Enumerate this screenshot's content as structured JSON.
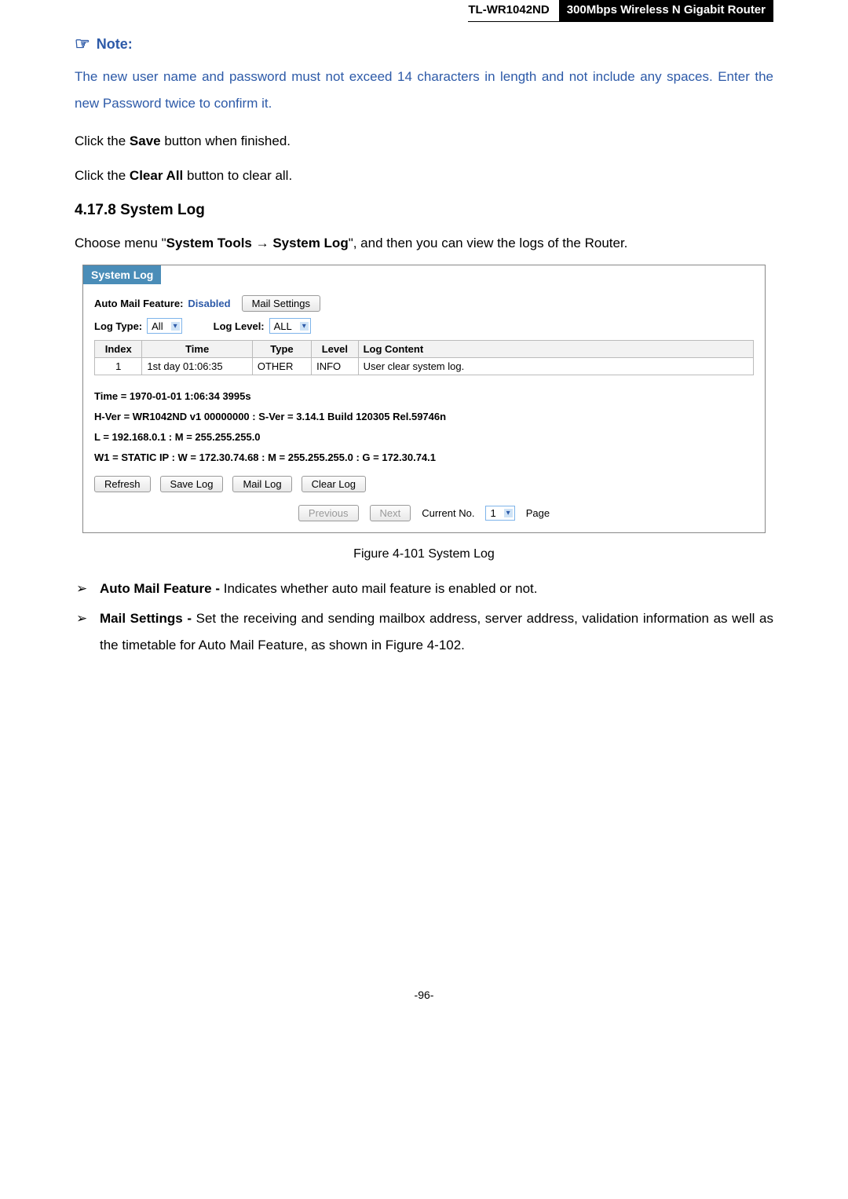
{
  "header": {
    "model": "TL-WR1042ND",
    "product": "300Mbps Wireless N Gigabit Router"
  },
  "note": {
    "label": "Note:",
    "text": "The new user name and password must not exceed 14 characters in length and not include any spaces. Enter the new Password twice to confirm it."
  },
  "para1_pre": "Click the ",
  "para1_bold": "Save",
  "para1_post": " button when finished.",
  "para2_pre": "Click the ",
  "para2_bold": "Clear All",
  "para2_post": " button to clear all.",
  "section_heading": "4.17.8  System Log",
  "choose_pre": "Choose menu \"",
  "choose_b1": "System Tools",
  "choose_arrow": " → ",
  "choose_b2": "System Log",
  "choose_post": "\", and then you can view the logs of the Router.",
  "syslog": {
    "title": "System Log",
    "auto_mail_label": "Auto Mail Feature:",
    "auto_mail_status": "Disabled",
    "mail_settings_btn": "Mail Settings",
    "log_type_label": "Log Type:",
    "log_type_value": "All",
    "log_level_label": "Log Level:",
    "log_level_value": "ALL",
    "headers": {
      "index": "Index",
      "time": "Time",
      "type": "Type",
      "level": "Level",
      "content": "Log Content"
    },
    "rows": [
      {
        "index": "1",
        "time": "1st day 01:06:35",
        "type": "OTHER",
        "level": "INFO",
        "content": "User clear system log."
      }
    ],
    "info": {
      "l1": "Time = 1970-01-01 1:06:34 3995s",
      "l2": "H-Ver = WR1042ND v1 00000000 : S-Ver = 3.14.1 Build 120305 Rel.59746n",
      "l3": "L = 192.168.0.1 : M = 255.255.255.0",
      "l4": "W1 = STATIC IP : W = 172.30.74.68 : M = 255.255.255.0 : G = 172.30.74.1"
    },
    "buttons": {
      "refresh": "Refresh",
      "save": "Save Log",
      "mail": "Mail Log",
      "clear": "Clear Log"
    },
    "pager": {
      "prev": "Previous",
      "next": "Next",
      "current_label": "Current No.",
      "current_value": "1",
      "page": "Page"
    }
  },
  "figure_caption": "Figure 4-101    System Log",
  "bullets": {
    "b1_bold": "Auto Mail Feature -",
    "b1_rest": " Indicates whether auto mail feature is enabled or not.",
    "b2_bold": "Mail Settings -",
    "b2_rest": " Set the receiving and sending mailbox address, server address, validation information as well as the timetable for Auto Mail Feature, as shown in Figure 4-102."
  },
  "page_number": "-96-"
}
